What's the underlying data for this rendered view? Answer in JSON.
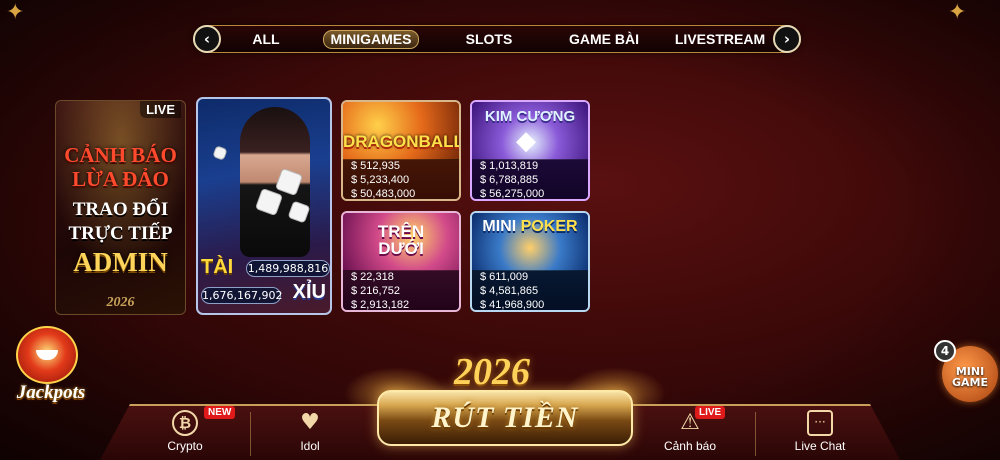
{
  "tabs": {
    "prev_label": "‹",
    "next_label": "›",
    "items": [
      "ALL",
      "MINIGAMES",
      "SLOTS",
      "GAME BÀI",
      "LIVESTREAM"
    ],
    "active": "MINIGAMES"
  },
  "live_banner": {
    "live_label": "LIVE",
    "line1": "CẢNH BÁO",
    "line2": "LỪA ĐẢO",
    "line3": "TRAO ĐỔI",
    "line4": "TRỰC TIẾP",
    "line5": "ADMIN",
    "year": "2026"
  },
  "taixiu": {
    "tai_label": "TÀI",
    "xiu_label": "XỈU",
    "tai_value": "1,489,988,816",
    "xiu_value": "1,676,167,902"
  },
  "games": [
    {
      "name": "DRAGONBALL",
      "values": [
        "$ 512,935",
        "$ 5,233,400",
        "$ 50,483,000"
      ]
    },
    {
      "name": "KIM CƯƠNG",
      "values": [
        "$ 1,013,819",
        "$ 6,788,885",
        "$ 56,275,000"
      ]
    },
    {
      "name_line1": "TRÊN",
      "name_line2": "DƯỚI",
      "values": [
        "$ 22,318",
        "$ 216,752",
        "$ 2,913,182"
      ]
    },
    {
      "name_line1": "MINI",
      "name_line2": "POKER",
      "values": [
        "$ 611,009",
        "$ 4,581,865",
        "$ 41,968,900"
      ]
    }
  ],
  "mini_game": {
    "count": "4",
    "line1": "MINI",
    "line2": "GAME"
  },
  "jackpots_label": "Jackpots",
  "year_banner": "2026",
  "bottom_nav": {
    "crypto": "Crypto",
    "crypto_tag": "NEW",
    "idol": "Idol",
    "cashout": "RÚT TIỀN",
    "canh_bao": "Cảnh báo",
    "canh_bao_tag": "LIVE",
    "live_chat": "Live Chat"
  },
  "icons": {
    "crypto": "bitcoin-icon",
    "idol": "heart-icon",
    "canh_bao": "warning-icon",
    "live_chat": "chat-icon"
  },
  "colors": {
    "background": "#3a0808",
    "gold": "#c9a05a",
    "tai": "#ffd83a",
    "live_tag": "#e01a1a"
  }
}
